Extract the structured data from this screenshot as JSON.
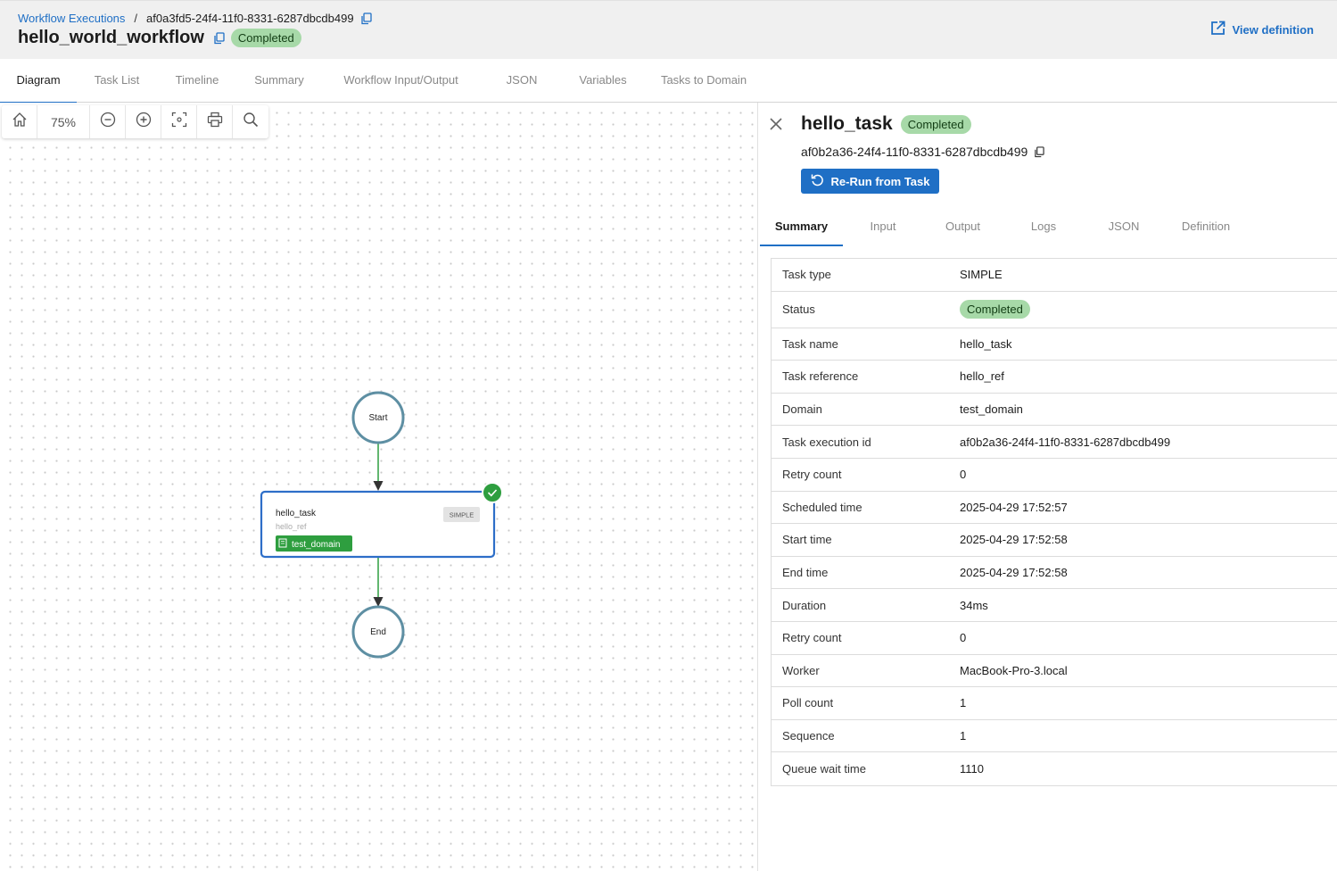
{
  "breadcrumb": {
    "parent": "Workflow Executions",
    "separator": "/",
    "current": "af0a3fd5-24f4-11f0-8331-6287dbcdb499"
  },
  "workflow": {
    "name": "hello_world_workflow",
    "status": "Completed"
  },
  "header": {
    "view_definition": "View definition"
  },
  "tabs": [
    "Diagram",
    "Task List",
    "Timeline",
    "Summary",
    "Workflow Input/Output",
    "JSON",
    "Variables",
    "Tasks to Domain"
  ],
  "active_tab": "Diagram",
  "toolbar": {
    "zoom_level": "75%",
    "tools": [
      "home-icon",
      "zoom-out-icon",
      "zoom-in-icon",
      "fit-view-icon",
      "print-icon",
      "search-icon"
    ]
  },
  "diagram": {
    "start_label": "Start",
    "end_label": "End",
    "task": {
      "name": "hello_task",
      "ref": "hello_ref",
      "type": "SIMPLE",
      "domain": "test_domain",
      "status_icon": "check-icon"
    }
  },
  "task_panel": {
    "title": "hello_task",
    "status": "Completed",
    "task_id": "af0b2a36-24f4-11f0-8331-6287dbcdb499",
    "rerun_label": "Re-Run from Task",
    "tabs": [
      "Summary",
      "Input",
      "Output",
      "Logs",
      "JSON",
      "Definition"
    ],
    "active_tab": "Summary",
    "rows": [
      {
        "key": "Task type",
        "value": "SIMPLE"
      },
      {
        "key": "Status",
        "value": "Completed"
      },
      {
        "key": "Task name",
        "value": "hello_task"
      },
      {
        "key": "Task reference",
        "value": "hello_ref"
      },
      {
        "key": "Domain",
        "value": "test_domain"
      },
      {
        "key": "Task execution id",
        "value": "af0b2a36-24f4-11f0-8331-6287dbcdb499"
      },
      {
        "key": "Retry count",
        "value": "0"
      },
      {
        "key": "Scheduled time",
        "value": "2025-04-29 17:52:57"
      },
      {
        "key": "Start time",
        "value": "2025-04-29 17:52:58"
      },
      {
        "key": "End time",
        "value": "2025-04-29 17:52:58"
      },
      {
        "key": "Duration",
        "value": "34ms"
      },
      {
        "key": "Retry count",
        "value": "0"
      },
      {
        "key": "Worker",
        "value": "MacBook-Pro-3.local"
      },
      {
        "key": "Poll count",
        "value": "1"
      },
      {
        "key": "Sequence",
        "value": "1"
      },
      {
        "key": "Queue wait time",
        "value": "1110"
      }
    ]
  },
  "colors": {
    "accent": "#1f6fc5",
    "success_badge": "#a7d9a8",
    "success_node": "#2e9e3f",
    "node_border": "#5e8fa3"
  }
}
